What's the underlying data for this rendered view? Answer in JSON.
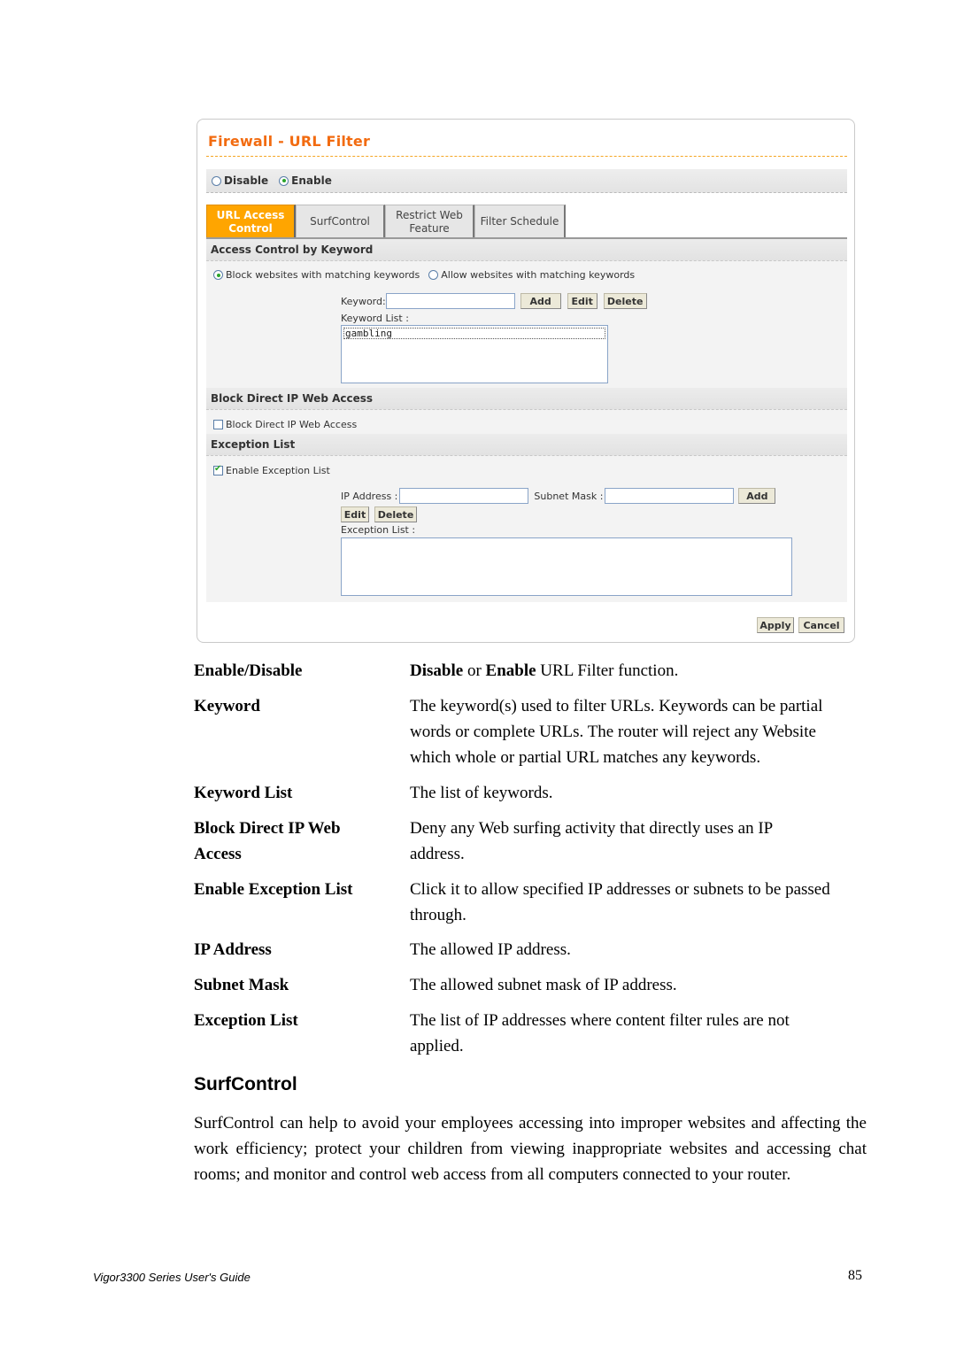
{
  "screenshot": {
    "title": "Firewall - URL Filter",
    "mode": {
      "options": [
        {
          "label": "Disable",
          "selected": false
        },
        {
          "label": "Enable",
          "selected": true
        }
      ]
    },
    "tabs": [
      {
        "label_line1": "URL Access",
        "label_line2": "Control",
        "active": true
      },
      {
        "label_line1": "SurfControl",
        "label_line2": "",
        "active": false
      },
      {
        "label_line1": "Restrict Web",
        "label_line2": "Feature",
        "active": false
      },
      {
        "label_line1": "Filter Schedule",
        "label_line2": "",
        "active": false
      }
    ],
    "access_control": {
      "heading": "Access Control by Keyword",
      "block_option": "Block websites with matching keywords",
      "allow_option": "Allow websites with matching keywords",
      "block_selected": true,
      "keyword_label": "Keyword:",
      "keyword_value": "",
      "add_label": "Add",
      "edit_label": "Edit",
      "delete_label": "Delete",
      "keyword_list_label": "Keyword List :",
      "keyword_list": [
        "gambling"
      ]
    },
    "block_direct_ip": {
      "heading": "Block Direct IP Web Access",
      "checkbox_label": "Block Direct IP Web Access",
      "checked": false
    },
    "exception": {
      "heading": "Exception List",
      "checkbox_label": "Enable Exception List",
      "checked": true,
      "ip_label": "IP Address :",
      "ip_value": "",
      "mask_label": "Subnet Mask :",
      "mask_value": "",
      "add_label": "Add",
      "edit_label": "Edit",
      "delete_label": "Delete",
      "list_label": "Exception List :"
    },
    "apply_label": "Apply",
    "cancel_label": "Cancel"
  },
  "definitions": [
    {
      "term": "Enable/Disable",
      "desc_html_parts": [
        "Disable",
        " or ",
        "Enable",
        " URL Filter function."
      ]
    },
    {
      "term": "Keyword",
      "desc": "The keyword(s) used to filter URLs. Keywords can be partial words or complete URLs. The router will reject any Website which whole or partial URL matches any keywords."
    },
    {
      "term": "Keyword List",
      "desc": "The list of keywords."
    },
    {
      "term": "Block Direct IP Web Access",
      "desc": "Deny any Web surfing activity that directly uses an IP address."
    },
    {
      "term": "Enable Exception List",
      "desc": "Click it to allow specified IP addresses or subnets to be passed through."
    },
    {
      "term": "IP Address",
      "desc": "The allowed IP address."
    },
    {
      "term": "Subnet Mask",
      "desc": "The allowed subnet mask of IP address."
    },
    {
      "term": "Exception List",
      "desc": "The list of IP addresses where content filter rules are not applied."
    }
  ],
  "section": {
    "heading": "SurfControl",
    "paragraph": "SurfControl can help to avoid your employees accessing into improper websites and affecting the work efficiency; protect your children from viewing inappropriate websites and accessing chat rooms; and monitor and control web access from all computers connected to your router."
  },
  "footer": {
    "guide_title": "Vigor3300 Series User's Guide",
    "page_number": "85"
  }
}
